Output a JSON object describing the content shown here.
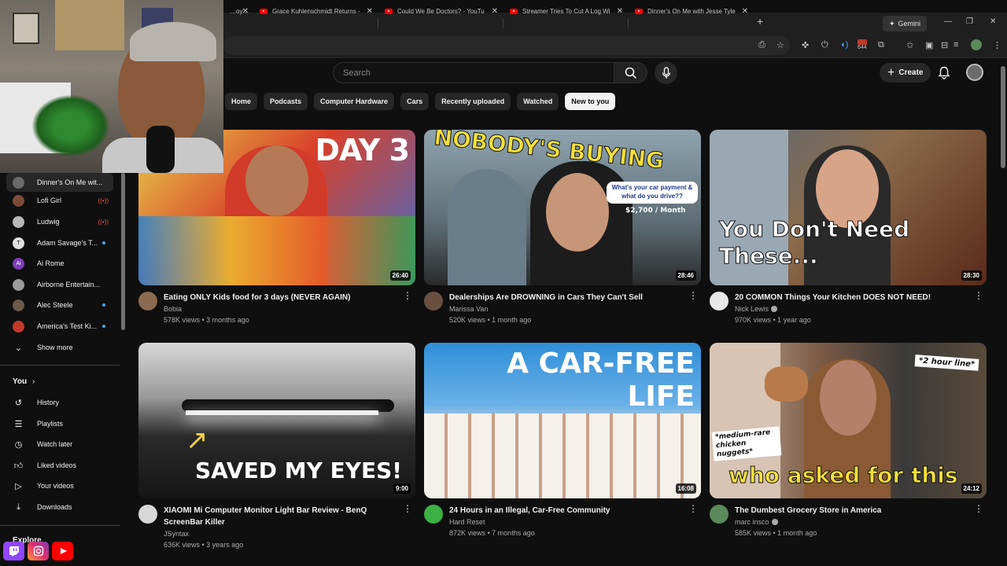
{
  "browser": {
    "tabs": [
      {
        "label": "…oy…"
      },
      {
        "label": "Grace Kuhlenschmidt Returns -"
      },
      {
        "label": "Could We Be Doctors? - YouTu"
      },
      {
        "label": "Streamer Tries To Cut A Log Wi"
      },
      {
        "label": "Dinner's On Me with Jesse Tyle"
      }
    ],
    "gemini_label": "Gemini",
    "extension_badge": "644"
  },
  "header": {
    "search_placeholder": "Search",
    "create_label": "Create"
  },
  "chips": [
    "Home",
    "Podcasts",
    "Computer Hardware",
    "Cars",
    "Recently uploaded",
    "Watched",
    "New to you"
  ],
  "sidebar": {
    "subscriptions": [
      {
        "label": "Dinner's On Me wit...",
        "color": "#6a6a6a",
        "letter": "",
        "status": "",
        "active": true
      },
      {
        "label": "Lofi Girl",
        "color": "#7a4a3a",
        "letter": "",
        "status": "live"
      },
      {
        "label": "Ludwig",
        "color": "#b9b9b9",
        "letter": "",
        "status": "live"
      },
      {
        "label": "Adam Savage's T...",
        "color": "#e0e0e0",
        "letter": "T",
        "status": "dot"
      },
      {
        "label": "Ai Rome",
        "color": "#7b3fb8",
        "letter": "Ai",
        "status": ""
      },
      {
        "label": "Airborne Entertain...",
        "color": "#9a9a9a",
        "letter": "",
        "status": ""
      },
      {
        "label": "Alec Steele",
        "color": "#6b5a4a",
        "letter": "",
        "status": "dot"
      },
      {
        "label": "America's Test Ki...",
        "color": "#c0392b",
        "letter": "",
        "status": "dot"
      }
    ],
    "show_more": "Show more",
    "you_label": "You",
    "you_items": [
      {
        "label": "History",
        "icon": "history-icon"
      },
      {
        "label": "Playlists",
        "icon": "playlists-icon"
      },
      {
        "label": "Watch later",
        "icon": "watch-later-icon"
      },
      {
        "label": "Liked videos",
        "icon": "liked-videos-icon"
      },
      {
        "label": "Your videos",
        "icon": "your-videos-icon"
      },
      {
        "label": "Downloads",
        "icon": "downloads-icon"
      }
    ],
    "explore_label": "Explore"
  },
  "videos": [
    {
      "title": "Eating ONLY Kids food for 3 days (NEVER AGAIN)",
      "channel": "Bobia",
      "verified": false,
      "stats": "578K views • 3 months ago",
      "duration": "26:40",
      "thumb_text": "DAY 3",
      "thumb_bg": "#c23b2a",
      "avatar": "#8a6a50"
    },
    {
      "title": "Dealerships Are DROWNING in Cars They Can't Sell",
      "channel": "Marissa Van",
      "verified": false,
      "stats": "520K views • 1 month ago",
      "duration": "28:46",
      "thumb_text": "NOBODY'S BUYING",
      "thumb_sub": "What's your car payment & what do you drive??",
      "thumb_price": "$2,700 / Month",
      "thumb_bg": "#5f6f78",
      "avatar": "#6a5040"
    },
    {
      "title": "20 COMMON Things Your Kitchen DOES NOT NEED!",
      "channel": "Nick Lewis",
      "verified": true,
      "stats": "970K views • 1 year ago",
      "duration": "28:30",
      "thumb_text": "You Don't Need These...",
      "thumb_bg": "#7a4a2a",
      "avatar": "#e8e8e8"
    },
    {
      "title": "XIAOMI Mi Computer Monitor Light Bar Review - BenQ ScreenBar Killer",
      "channel": "JSyntax",
      "verified": false,
      "stats": "636K views • 3 years ago",
      "duration": "9:00",
      "thumb_text": "SAVED MY EYES!",
      "thumb_bg": "#3a3a3a",
      "avatar": "#d8d8d8"
    },
    {
      "title": "24 Hours in an Illegal, Car-Free Community",
      "channel": "Hard Reset",
      "verified": false,
      "stats": "872K views • 7 months ago",
      "duration": "16:08",
      "thumb_text": "A CAR-FREE LIFE",
      "thumb_bg": "#2f8fd8",
      "avatar": "#3cb043"
    },
    {
      "title": "The Dumbest Grocery Store in America",
      "channel": "marc insco",
      "verified": true,
      "stats": "585K views • 1 month ago",
      "duration": "24:12",
      "thumb_text": "who asked for this",
      "thumb_tag1": "*2 hour line*",
      "thumb_tag2": "*medium-rare chicken nuggets*",
      "thumb_bg": "#6a5240",
      "avatar": "#5a8a5a"
    }
  ]
}
